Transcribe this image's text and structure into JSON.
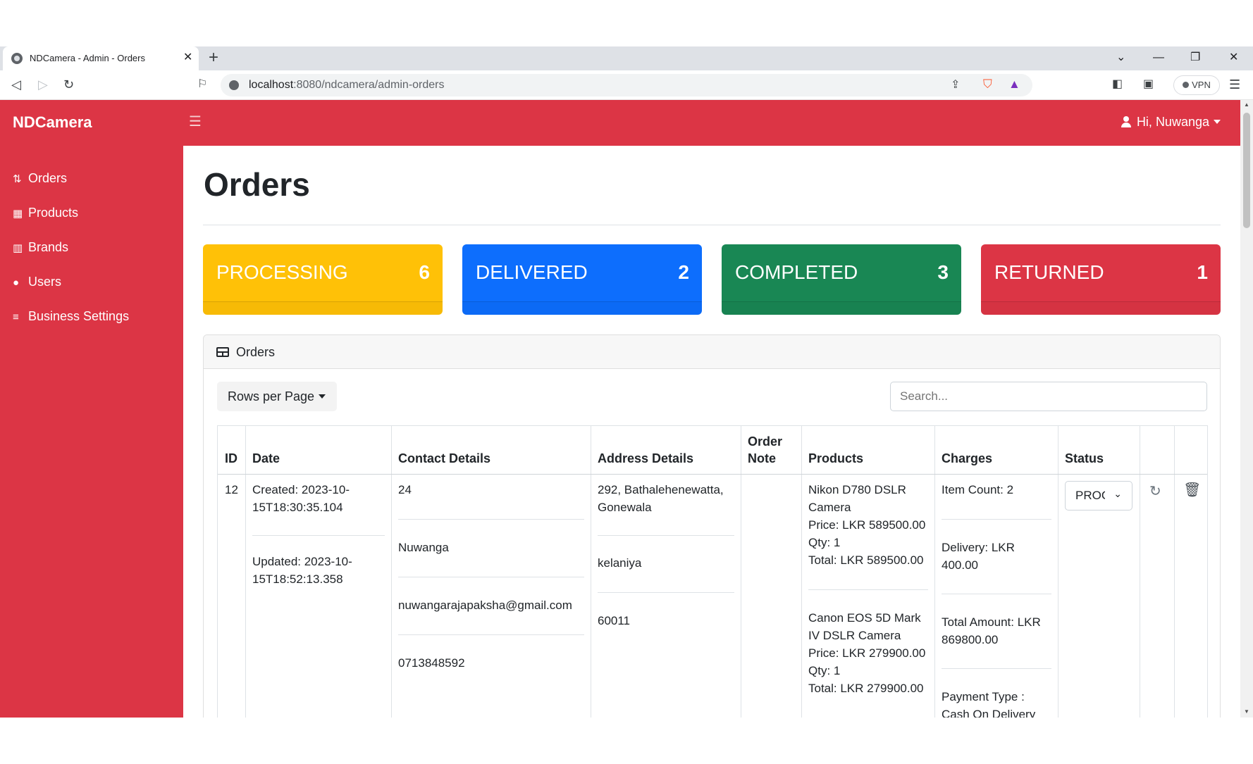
{
  "browser": {
    "tab_title": "NDCamera - Admin - Orders",
    "url_host": "localhost",
    "url_rest": ":8080/ndcamera/admin-orders",
    "vpn_label": "VPN"
  },
  "app": {
    "brand": "NDCamera",
    "greeting": "Hi, Nuwanga",
    "sidebar": [
      {
        "label": "Orders",
        "icon": "sort-icon"
      },
      {
        "label": "Products",
        "icon": "boxes-icon"
      },
      {
        "label": "Brands",
        "icon": "building-icon"
      },
      {
        "label": "Users",
        "icon": "users-icon"
      },
      {
        "label": "Business Settings",
        "icon": "sliders-icon"
      }
    ]
  },
  "page": {
    "title": "Orders",
    "cards": [
      {
        "label": "PROCESSING",
        "count": "6",
        "color": "#ffc107"
      },
      {
        "label": "DELIVERED",
        "count": "2",
        "color": "#0d6efd"
      },
      {
        "label": "COMPLETED",
        "count": "3",
        "color": "#198754"
      },
      {
        "label": "RETURNED",
        "count": "1",
        "color": "#dc3545"
      }
    ],
    "panel_title": "Orders",
    "rows_per_page": "Rows per Page",
    "search_placeholder": "Search..."
  },
  "table": {
    "headers": {
      "id": "ID",
      "date": "Date",
      "contact": "Contact Details",
      "address": "Address Details",
      "note_line1": "Order",
      "note_line2": "Note",
      "products": "Products",
      "charges": "Charges",
      "status": "Status"
    },
    "row": {
      "id": "12",
      "created": "Created: 2023-10-15T18:30:35.104",
      "updated": "Updated: 2023-10-15T18:52:13.358",
      "contact_id": "24",
      "contact_name": "Nuwanga",
      "contact_email": "nuwangarajapaksha@gmail.com",
      "contact_phone": "0713848592",
      "address_line": "292, Bathalehenewatta, Gonewala",
      "address_city": "kelaniya",
      "address_zip": "60011",
      "product1_name": "Nikon D780 DSLR Camera",
      "product1_price": "Price: LKR 589500.00",
      "product1_qty": "Qty: 1",
      "product1_total": "Total: LKR 589500.00",
      "product2_name": "Canon EOS 5D Mark IV DSLR Camera",
      "product2_price": "Price: LKR 279900.00",
      "product2_qty": "Qty: 1",
      "product2_total": "Total: LKR 279900.00",
      "item_count": "Item Count: 2",
      "delivery": "Delivery: LKR 400.00",
      "total_amount": "Total Amount: LKR 869800.00",
      "payment_type": "Payment Type : Cash On Delivery",
      "status": "PROCESSING"
    }
  }
}
